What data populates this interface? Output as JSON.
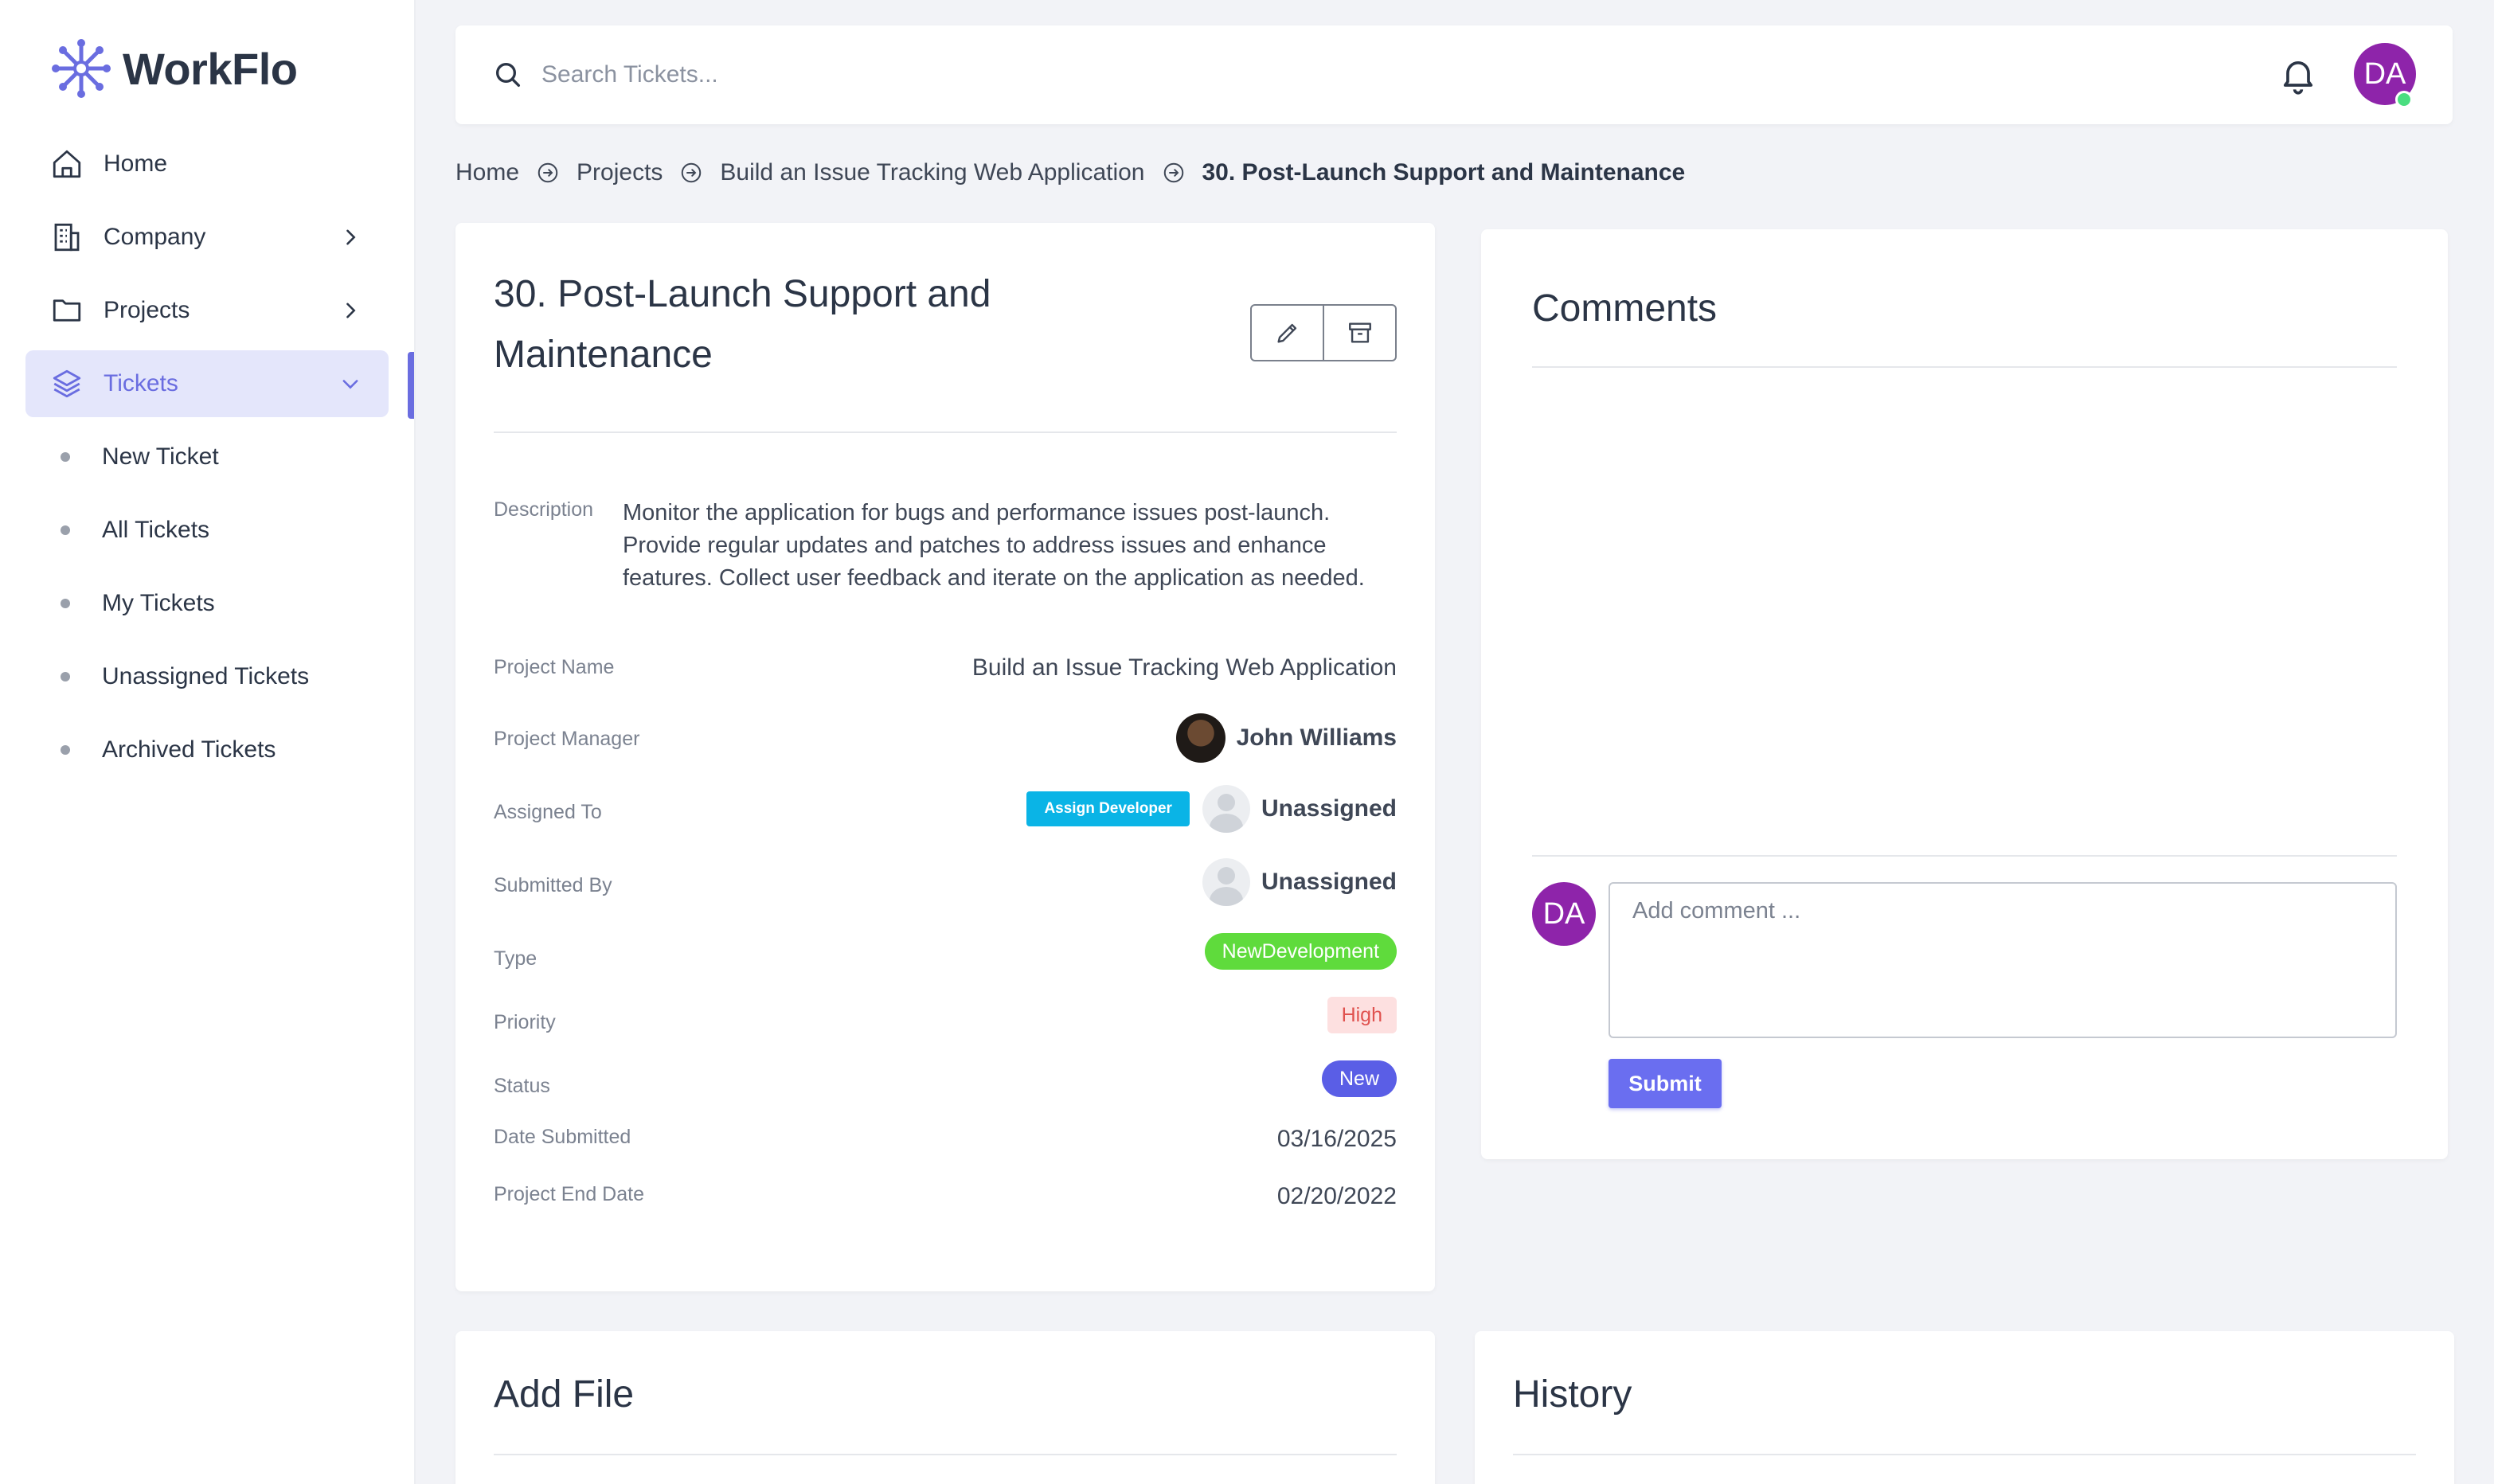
{
  "brand": {
    "name": "WorkFlo",
    "accent": "#6a6de0"
  },
  "sidebar": {
    "items": [
      {
        "label": "Home",
        "icon": "home-icon"
      },
      {
        "label": "Company",
        "icon": "building-icon"
      },
      {
        "label": "Projects",
        "icon": "folder-icon"
      },
      {
        "label": "Tickets",
        "icon": "layers-icon",
        "active": true
      }
    ],
    "sub_items": [
      {
        "label": "New Ticket"
      },
      {
        "label": "All Tickets"
      },
      {
        "label": "My Tickets"
      },
      {
        "label": "Unassigned Tickets"
      },
      {
        "label": "Archived Tickets"
      }
    ]
  },
  "topbar": {
    "search_placeholder": "Search Tickets...",
    "user_initials": "DA",
    "avatar_color": "#8e24aa"
  },
  "breadcrumb": {
    "items": [
      "Home",
      "Projects",
      "Build an Issue Tracking Web Application",
      "30. Post-Launch Support and Maintenance"
    ]
  },
  "ticket": {
    "title": "30. Post-Launch Support and Maintenance",
    "description_label": "Description",
    "description": "Monitor the application for bugs and performance issues post-launch. Provide regular updates and patches to address issues and enhance features. Collect user feedback and iterate on the application as needed.",
    "project_name_label": "Project Name",
    "project_name": "Build an Issue Tracking Web Application",
    "project_manager_label": "Project Manager",
    "project_manager": "John Williams",
    "assigned_to_label": "Assigned To",
    "assign_button": "Assign Developer",
    "assigned_to": "Unassigned",
    "submitted_by_label": "Submitted By",
    "submitted_by": "Unassigned",
    "type_label": "Type",
    "type": "NewDevelopment",
    "priority_label": "Priority",
    "priority": "High",
    "status_label": "Status",
    "status": "New",
    "date_submitted_label": "Date Submitted",
    "date_submitted": "03/16/2025",
    "project_end_date_label": "Project End Date",
    "project_end_date": "02/20/2022"
  },
  "comments": {
    "title": "Comments",
    "placeholder": "Add comment ...",
    "submit_label": "Submit",
    "user_initials": "DA"
  },
  "add_file": {
    "title": "Add File"
  },
  "history": {
    "title": "History"
  }
}
